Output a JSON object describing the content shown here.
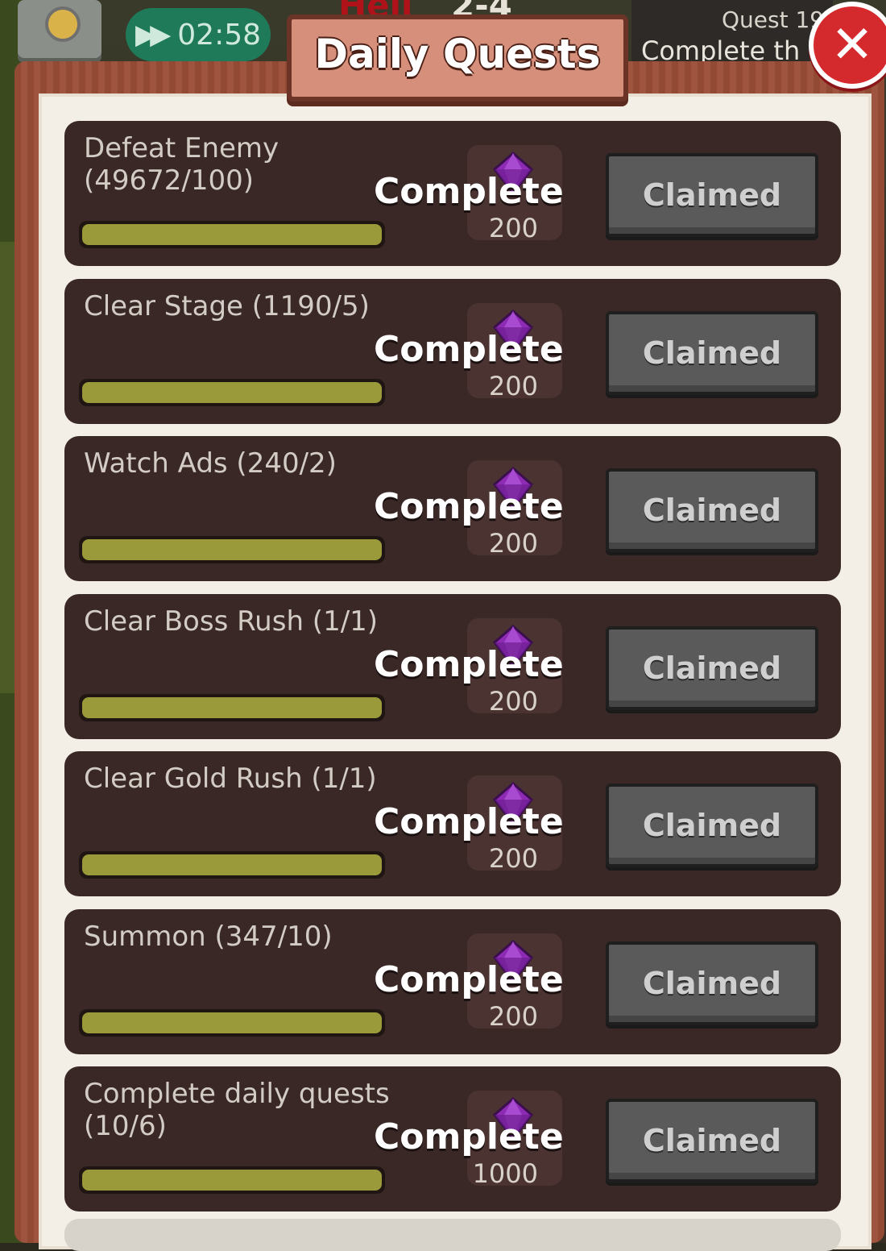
{
  "hud": {
    "timer": "02:58",
    "timer_icon": "fast-forward-icon",
    "stage_label": "Hell",
    "stage_number": "2-4",
    "quest_label": "Quest 19",
    "quest_preview": "Complete th"
  },
  "popup": {
    "title": "Daily Quests",
    "close_icon": "close-x-icon"
  },
  "quests": [
    {
      "name": "Defeat Enemy (49672/100)",
      "progress": 1.0,
      "status": "Complete",
      "reward_icon": "purple-gem-icon",
      "reward_amount": "200",
      "button_label": "Claimed"
    },
    {
      "name": "Clear Stage (1190/5)",
      "progress": 1.0,
      "status": "Complete",
      "reward_icon": "purple-gem-icon",
      "reward_amount": "200",
      "button_label": "Claimed"
    },
    {
      "name": "Watch Ads (240/2)",
      "progress": 1.0,
      "status": "Complete",
      "reward_icon": "purple-gem-icon",
      "reward_amount": "200",
      "button_label": "Claimed"
    },
    {
      "name": "Clear Boss Rush (1/1)",
      "progress": 1.0,
      "status": "Complete",
      "reward_icon": "purple-gem-icon",
      "reward_amount": "200",
      "button_label": "Claimed"
    },
    {
      "name": "Clear Gold Rush (1/1)",
      "progress": 1.0,
      "status": "Complete",
      "reward_icon": "purple-gem-icon",
      "reward_amount": "200",
      "button_label": "Claimed"
    },
    {
      "name": "Summon (347/10)",
      "progress": 1.0,
      "status": "Complete",
      "reward_icon": "purple-gem-icon",
      "reward_amount": "200",
      "button_label": "Claimed"
    },
    {
      "name": "Complete daily quests (10/6)",
      "progress": 1.0,
      "status": "Complete",
      "reward_icon": "purple-gem-icon",
      "reward_amount": "1000",
      "button_label": "Claimed"
    }
  ],
  "colors": {
    "row_bg": "#3a2826",
    "progress_fill": "#9a9a3a",
    "claimed_button": "#5a5a5a",
    "close_button": "#d52a2d",
    "gem": "#8e2bb5"
  }
}
